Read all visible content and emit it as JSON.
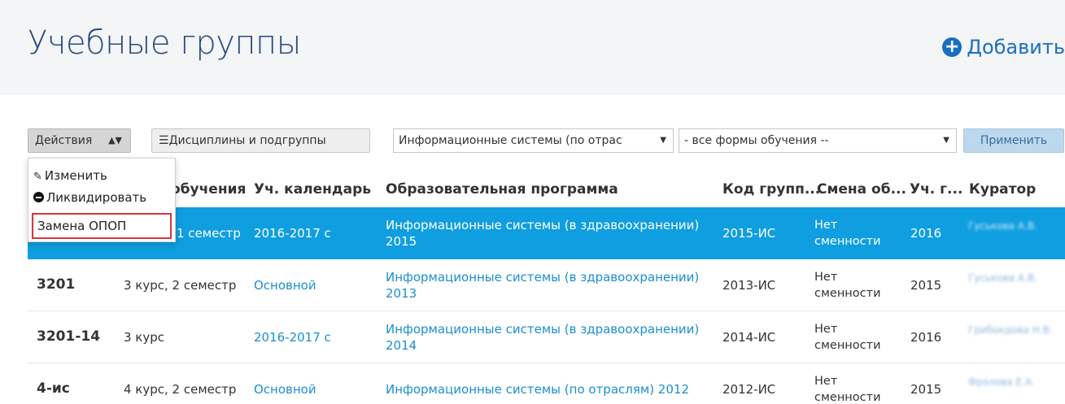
{
  "header": {
    "title": "Учебные группы",
    "add_label": "Добавить"
  },
  "toolbar": {
    "actions_label": "Действия",
    "disciplines_label": "Дисциплины и подгруппы",
    "program_select_value": "Информационные системы (по отрас",
    "form_select_value": "- все формы обучения --",
    "apply_label": "Применить"
  },
  "actions_menu": {
    "edit": "Изменить",
    "liquidate": "Ликвидировать",
    "replace": "Замена ОПОП"
  },
  "table": {
    "columns": {
      "year": "обучения",
      "calendar": "Уч. календарь",
      "program": "Образовательная программа",
      "code": "Код групп...",
      "shift": "Смена об...",
      "study_year": "Уч. г...",
      "curator": "Куратор"
    },
    "rows": [
      {
        "name": "",
        "year": "1 семестр",
        "calendar": "2016-2017 с",
        "program": "Информационные системы (в здравоохранении) 2015",
        "code": "2015-ИС",
        "shift": "Нет сменности",
        "study_year": "2016",
        "curator": "Гуськова А.В."
      },
      {
        "name": "3201",
        "year": "3 курс, 2 семестр",
        "calendar": "Основной",
        "program": "Информационные системы (в здравоохранении) 2013",
        "code": "2013-ИС",
        "shift": "Нет сменности",
        "study_year": "2015",
        "curator": "Гуськова А.В."
      },
      {
        "name": "3201-14",
        "year": "3 курс",
        "calendar": "2016-2017 с",
        "program": "Информационные системы (в здравоохранении) 2014",
        "code": "2014-ИС",
        "shift": "Нет сменности",
        "study_year": "2016",
        "curator": "Грибоедова Н.В."
      },
      {
        "name": "4-ис",
        "year": "4 курс, 2 семестр",
        "calendar": "Основной",
        "program": "Информационные системы (по отраслям) 2012",
        "code": "2012-ИС",
        "shift": "Нет сменности",
        "study_year": "2015",
        "curator": "Фролова Е.А."
      }
    ]
  },
  "colors": {
    "title": "#2a4b7c",
    "link": "#1a8fd3",
    "selected_row": "#0f9ee0",
    "highlight_border": "#d9343a"
  }
}
